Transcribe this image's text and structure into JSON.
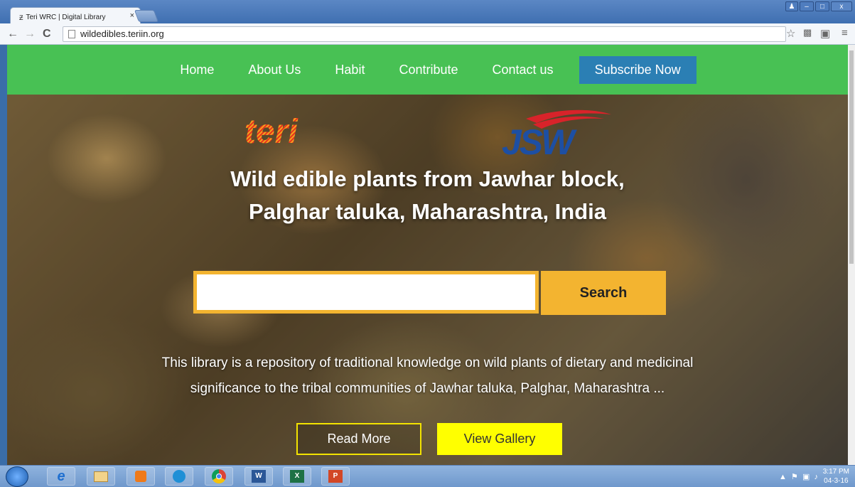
{
  "browser": {
    "tab_title": "Teri WRC | Digital Library",
    "tab_close": "×",
    "url": "wildedibles.teriin.org",
    "back_icon": "←",
    "forward_icon": "→",
    "reload_icon": "C",
    "star_icon": "☆",
    "menu_icon": "≡"
  },
  "nav": {
    "items": [
      {
        "label": "Home"
      },
      {
        "label": "About Us"
      },
      {
        "label": "Habit"
      },
      {
        "label": "Contribute"
      },
      {
        "label": "Contact us"
      }
    ],
    "subscribe": "Subscribe Now"
  },
  "hero": {
    "logos": {
      "teri": "teri",
      "jsw": "JSW"
    },
    "headline_line1": "Wild edible plants from Jawhar block,",
    "headline_line2": "Palghar taluka, Maharashtra, India",
    "search_value": "",
    "search_button": "Search",
    "desc_line1": "This library is a repository of traditional knowledge on wild plants of dietary and medicinal",
    "desc_line2": "significance to the tribal communities of Jawhar taluka, Palghar, Maharashtra ...",
    "read_more": "Read More",
    "view_gallery": "View Gallery"
  },
  "taskbar": {
    "apps": [
      "ie-icon",
      "file-explorer-icon",
      "media-player-icon",
      "network-icon",
      "chrome-icon",
      "word-icon",
      "excel-icon",
      "powerpoint-icon"
    ],
    "time": "3:17 PM",
    "date": "04-3-16"
  },
  "colors": {
    "nav_green": "#48c154",
    "subscribe_blue": "#2b7fb4",
    "search_yellow": "#f3b430",
    "gallery_yellow": "#ffff00"
  }
}
